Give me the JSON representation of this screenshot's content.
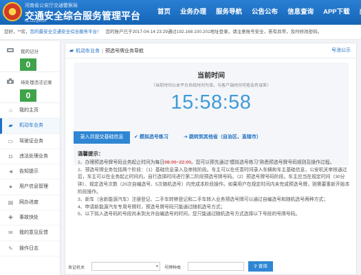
{
  "header": {
    "sub_title": "河南省公安厅交通警察局",
    "title": "交通安全综合服务管理平台",
    "url": "ha.122.gov.cn",
    "nav": [
      "首页",
      "业务办理",
      "服务导航",
      "公告公布",
      "信息查询",
      "APP下载",
      "办事指南"
    ]
  },
  "notice": {
    "greeting": "您好，**欢，",
    "welcome": "您的最安全交通安全综合服务平台！",
    "last_login": "您的账户已于2017-04-14 23:29通过192.168.100.201地址登录，请注意账号安全，若有异常，及时修改密码。"
  },
  "sidebar": {
    "stats": [
      {
        "label": "我的记分",
        "value": "0"
      },
      {
        "label": "待处理违法记录",
        "value": "0"
      }
    ],
    "items": [
      "我的主页",
      "机动车业务",
      "驾驶证业务",
      "违法处理业务",
      "告知提示",
      "用户信息管理",
      "网办进度",
      "事故快处",
      "我的意见反馈",
      "操作日志"
    ]
  },
  "breadcrumb": {
    "section": "机动车业务",
    "sep": "|",
    "page": "预选号牌业务导航",
    "right_link": "号池公示"
  },
  "time_panel": {
    "title": "当前时间",
    "note": "（当前时间以本平台系统时间为准，与客户端时间可能会有误差）",
    "value": "15:58:58"
  },
  "actions": {
    "primary": "录入并提交基础信息",
    "simulate": "模拟选号练习",
    "jump": "跳转到其他省（自治区、直辖市）"
  },
  "tips": {
    "title": "温馨提示：",
    "line1_pre": "1、办理预选号牌号码业务起止时间为每日",
    "line1_time": "08:00~22:00",
    "line1_post": "。您可以预先通过“模拟选号练习”熟悉预选号牌号码规则及操作过程。",
    "line2": "2、预选号牌业务包括两个阶段：（1）基础信息录入及审核阶段。车主可以在任意时间录入车辆和车主基础信息，公安机关审核通过后，车主可以在业务起止时间内，自行选择时间进行第二阶段预选号牌号码。（2）预选号牌号码阶段。车主应当在规定时间（30分钟）、规定选号次数（20次自编选号、5次随机选号）内完成本阶段操作。如果用户在规定时间内未完成预选号牌，则需要重新开始本阶段操作。",
    "line3": "3、新车（含新能源汽车）注册登记、二手车转移登记和二手车转入业务预选号牌可以通过自编选号和随机选号两种方式；",
    "line4": "4、申请新能源汽车专用号牌时，预选号牌号码只能通过随机选号方式；",
    "line5": "5、以下拟入选号码的号段尚未到允许自编选号的时间，您只能通过随机选号方式选择以下号段的号牌号码。"
  },
  "query_form": {
    "org_label": "发证机关",
    "plate_label": "号牌种类",
    "query_label": "查询"
  }
}
